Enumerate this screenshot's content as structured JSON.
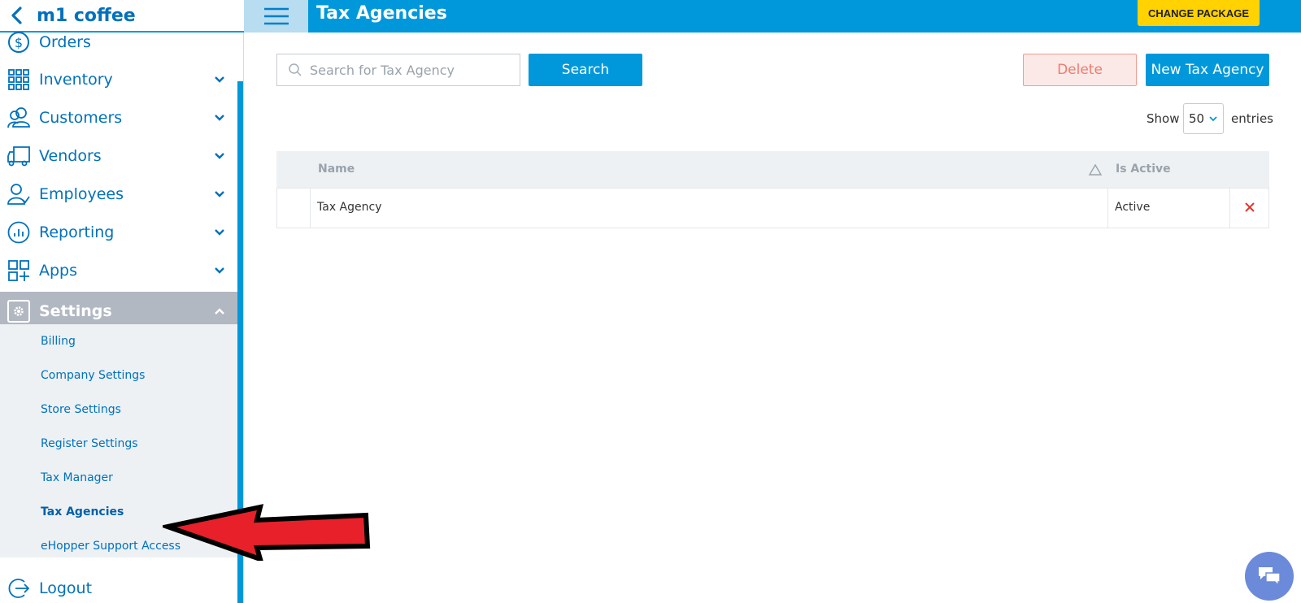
{
  "sidebar": {
    "title": "m1 coffee",
    "items": [
      {
        "label": "Orders",
        "icon": "dollar-circle-icon"
      },
      {
        "label": "Inventory",
        "icon": "grid-icon"
      },
      {
        "label": "Customers",
        "icon": "customers-icon"
      },
      {
        "label": "Vendors",
        "icon": "truck-icon"
      },
      {
        "label": "Employees",
        "icon": "employees-icon"
      },
      {
        "label": "Reporting",
        "icon": "chart-icon"
      },
      {
        "label": "Apps",
        "icon": "apps-icon"
      },
      {
        "label": "Settings",
        "icon": "gear-icon"
      },
      {
        "label": "Logout",
        "icon": "logout-icon"
      }
    ],
    "settings_sub": [
      {
        "label": "Billing"
      },
      {
        "label": "Company Settings"
      },
      {
        "label": "Store Settings"
      },
      {
        "label": "Register Settings"
      },
      {
        "label": "Tax Manager"
      },
      {
        "label": "Tax Agencies"
      },
      {
        "label": "eHopper Support Access"
      }
    ]
  },
  "header": {
    "title": "Tax Agencies",
    "change_package": "CHANGE PACKAGE"
  },
  "toolbar": {
    "search_placeholder": "Search for Tax Agency",
    "search_value": "",
    "search_button": "Search",
    "delete_button": "Delete",
    "new_button": "New Tax Agency",
    "show_label": "Show",
    "entries_value": "50",
    "entries_label": "entries"
  },
  "table": {
    "columns": [
      "Name",
      "Is Active"
    ],
    "rows": [
      {
        "name": "Tax Agency",
        "status": "Active"
      }
    ]
  },
  "colors": {
    "primary": "#0098db",
    "sidebar_text": "#0071bc",
    "settings_bg": "#b2b8c2",
    "yellow": "#ffd200",
    "delete": "#f07b6e",
    "annotation_arrow": "#e8202a"
  }
}
